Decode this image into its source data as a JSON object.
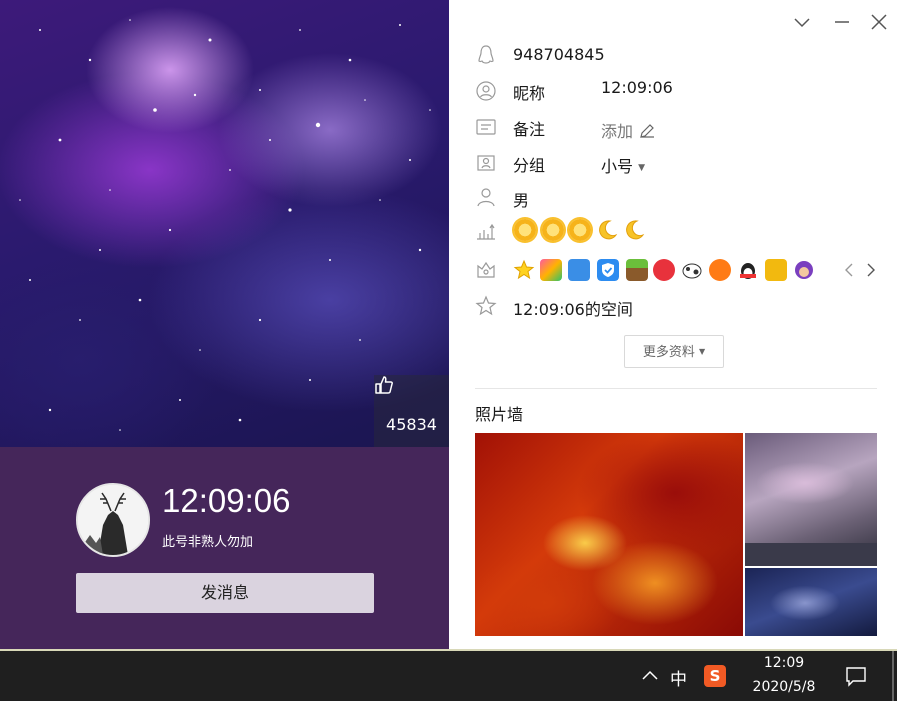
{
  "window": {
    "controls": [
      "chevron-down-icon",
      "minimize-icon",
      "close-icon"
    ]
  },
  "cover": {
    "like_count": "45834"
  },
  "profile": {
    "nickname_big": "12:09:06",
    "signature": "此号非熟人勿加",
    "send_button": "发消息"
  },
  "info": {
    "qq_number": "948704845",
    "nickname_label": "昵称",
    "nickname_value": "12:09:06",
    "remark_label": "备注",
    "remark_value": "添加",
    "group_label": "分组",
    "group_value": "小号",
    "gender": "男",
    "level_icons": [
      "sun",
      "sun",
      "sun",
      "moon",
      "moon"
    ],
    "privilege_icons": [
      "star-badge",
      "app-badge",
      "camera-badge",
      "shield-badge",
      "plant-badge",
      "heart-badge",
      "cow-badge",
      "circle-badge",
      "penguin-badge",
      "lock-badge",
      "game-badge"
    ],
    "space_link": "12:09:06的空间",
    "more_button": "更多资料"
  },
  "photo_wall": {
    "title": "照片墙"
  },
  "taskbar": {
    "ime": "中",
    "sogou": "S",
    "time": "12:09",
    "date": "2020/5/8"
  }
}
